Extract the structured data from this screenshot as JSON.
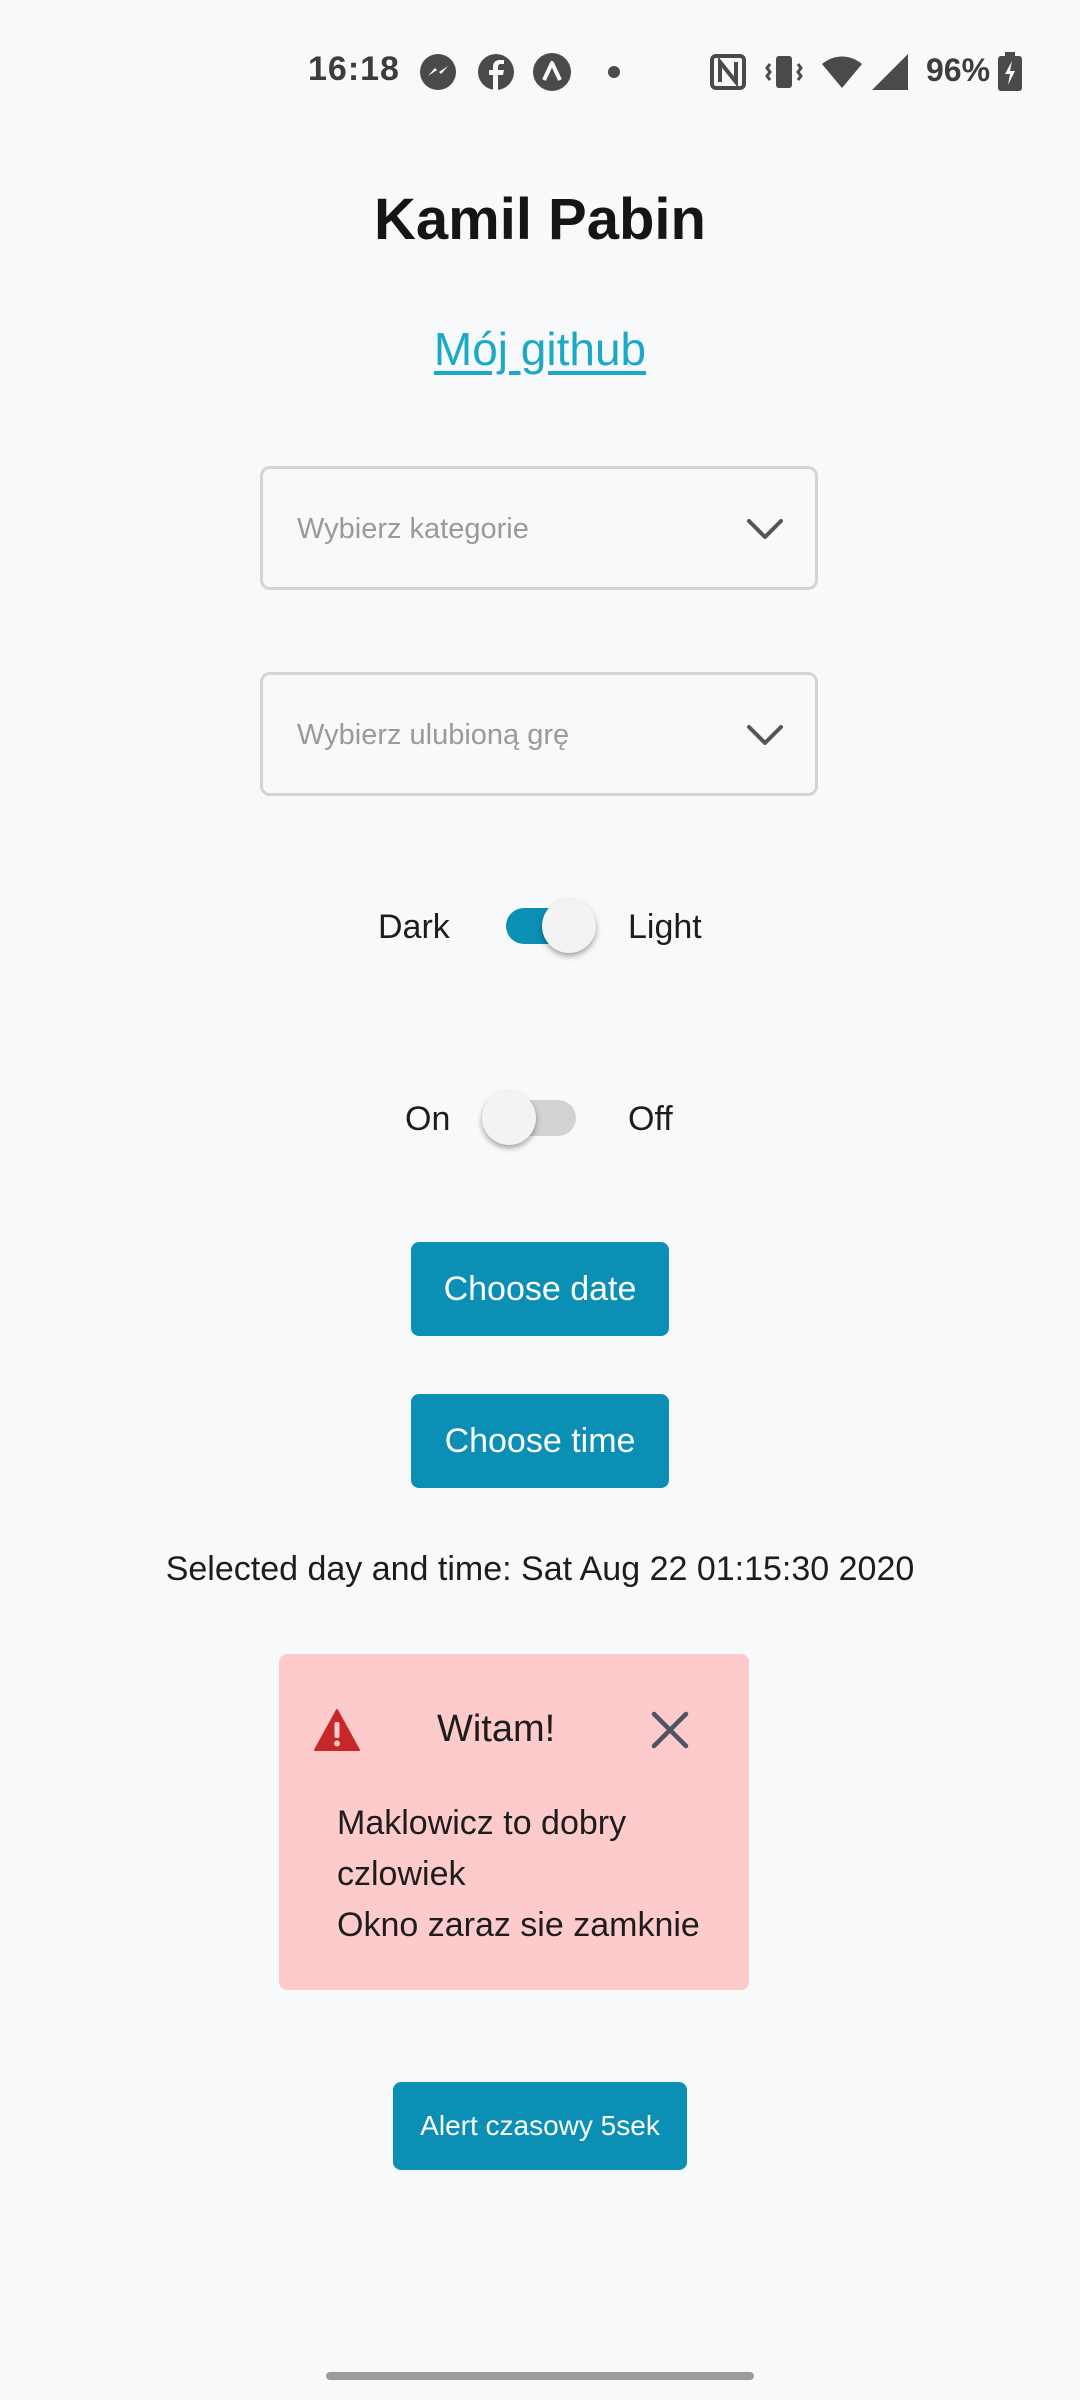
{
  "status_bar": {
    "time": "16:18",
    "battery_percent": "96%",
    "icons": [
      "messenger-icon",
      "facebook-icon",
      "app-notification-icon",
      "dot-icon",
      "nfc-icon",
      "vibrate-icon",
      "wifi-icon",
      "signal-icon",
      "battery-charging-icon"
    ]
  },
  "header": {
    "title": "Kamil Pabin",
    "github_link": "Mój github"
  },
  "dropdowns": {
    "category_placeholder": "Wybierz kategorie",
    "game_placeholder": "Wybierz ulubioną grę"
  },
  "theme_switch": {
    "left_label": "Dark",
    "right_label": "Light",
    "checked": true
  },
  "power_switch": {
    "left_label": "On",
    "right_label": "Off",
    "checked": false
  },
  "buttons": {
    "choose_date": "Choose date",
    "choose_time": "Choose time",
    "timed_alert": "Alert czasowy 5sek"
  },
  "selected_datetime": "Selected day and time: Sat Aug 22 01:15:30 2020",
  "alert": {
    "title": "Witam!",
    "lines": [
      "Maklowicz to dobry",
      "czlowiek",
      "Okno zaraz sie zamknie"
    ]
  },
  "colors": {
    "accent": "#0b8fb5",
    "link": "#1ca9c9",
    "alert_bg": "#fdcbcb",
    "alert_icon": "#c62828"
  }
}
